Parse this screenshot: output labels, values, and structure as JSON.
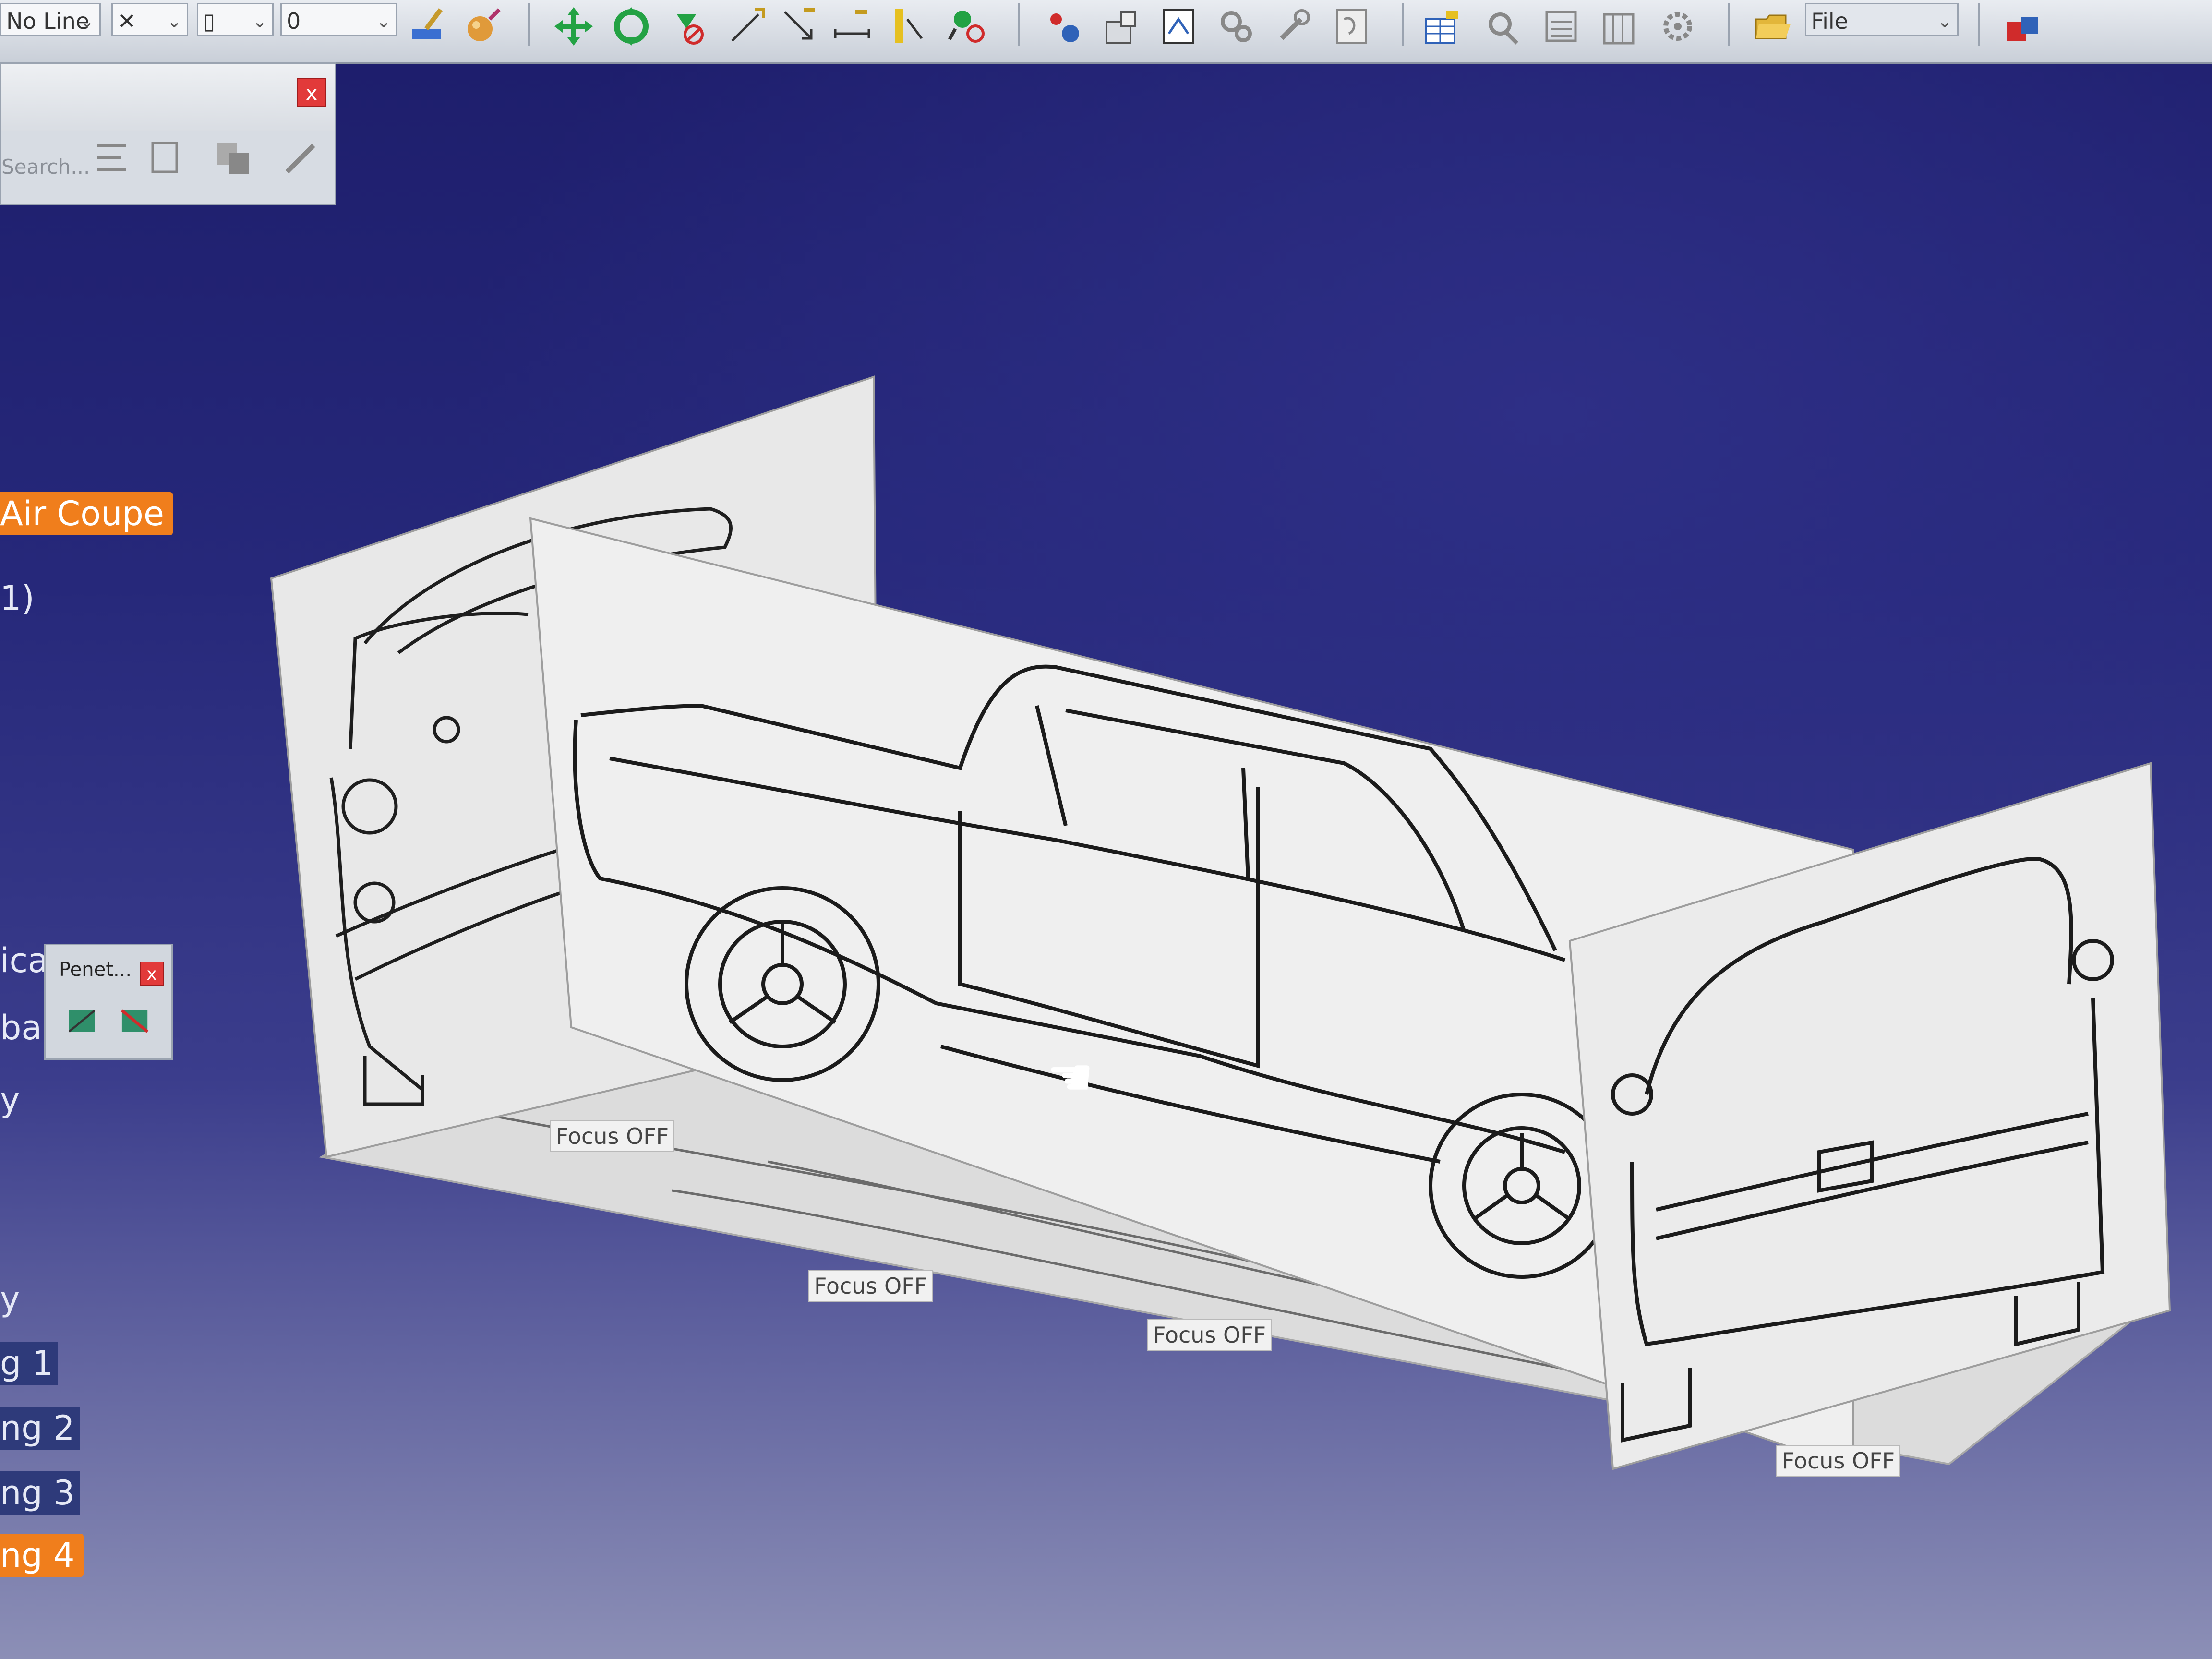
{
  "toolbar": {
    "line_type_combo": "No Line",
    "second_combo": "",
    "third_combo": "",
    "value_combo": "0",
    "file_combo": "File",
    "icons": [
      "paintbrush-icon",
      "sphere-icon",
      "move-arrows-icon",
      "rotate-arrows-icon",
      "no-snap-icon",
      "pointer-arrow-icon",
      "arrow-down-right-icon",
      "dimension-icon",
      "ruler-icon",
      "magnifier-icon",
      "component-icon",
      "properties-icon",
      "image-icon",
      "gear-cluster-icon",
      "tools-icon",
      "drawing-icon",
      "table-icon",
      "analysis-icon",
      "list-icon",
      "list2-icon",
      "gear-icon",
      "folder-open-icon",
      "network-icon"
    ]
  },
  "search_palette": {
    "search_placeholder": "Search...",
    "close_label": "x"
  },
  "tree": {
    "product_label": "Air Coupe",
    "item_1": "1)",
    "item_ica": "ica",
    "item_bac": "bac",
    "item_y1": "y",
    "item_y2": "y",
    "img1": "g 1",
    "img2": "ng 2",
    "img3": "ng 3",
    "img4": "ng 4"
  },
  "penetrate_palette": {
    "title": "Penet...",
    "close_label": "x"
  },
  "viewport": {
    "focus_labels": [
      "Focus OFF",
      "Focus OFF",
      "Focus OFF",
      "Focus OFF"
    ]
  },
  "colors": {
    "background_top": "#1d1d6b",
    "background_bottom": "#8c8fb6",
    "highlight": "#f07e1c",
    "close_button": "#e23a3a"
  }
}
